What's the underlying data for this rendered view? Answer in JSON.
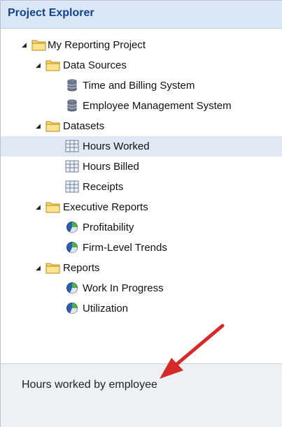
{
  "panel": {
    "title": "Project Explorer"
  },
  "tree": {
    "root": "My Reporting Project",
    "data_sources": {
      "label": "Data Sources",
      "items": [
        "Time and Billing System",
        "Employee Management System"
      ]
    },
    "datasets": {
      "label": "Datasets",
      "items": [
        "Hours Worked",
        "Hours Billed",
        "Receipts"
      ],
      "selected": "Hours Worked"
    },
    "executive_reports": {
      "label": "Executive Reports",
      "items": [
        "Profitability",
        "Firm-Level Trends"
      ]
    },
    "reports": {
      "label": "Reports",
      "items": [
        "Work In Progress",
        "Utilization"
      ]
    }
  },
  "description": {
    "text": "Hours worked by employee"
  },
  "colors": {
    "header_bg": "#d9e7f7",
    "header_text": "#15428b",
    "selected_row": "#dfe8f3",
    "annotation_arrow": "#d42a2a"
  },
  "icons": {
    "folder": "folder-icon",
    "database": "database-icon",
    "dataset": "grid-icon",
    "report": "report-icon",
    "expanded": "expand-arrow-icon"
  }
}
